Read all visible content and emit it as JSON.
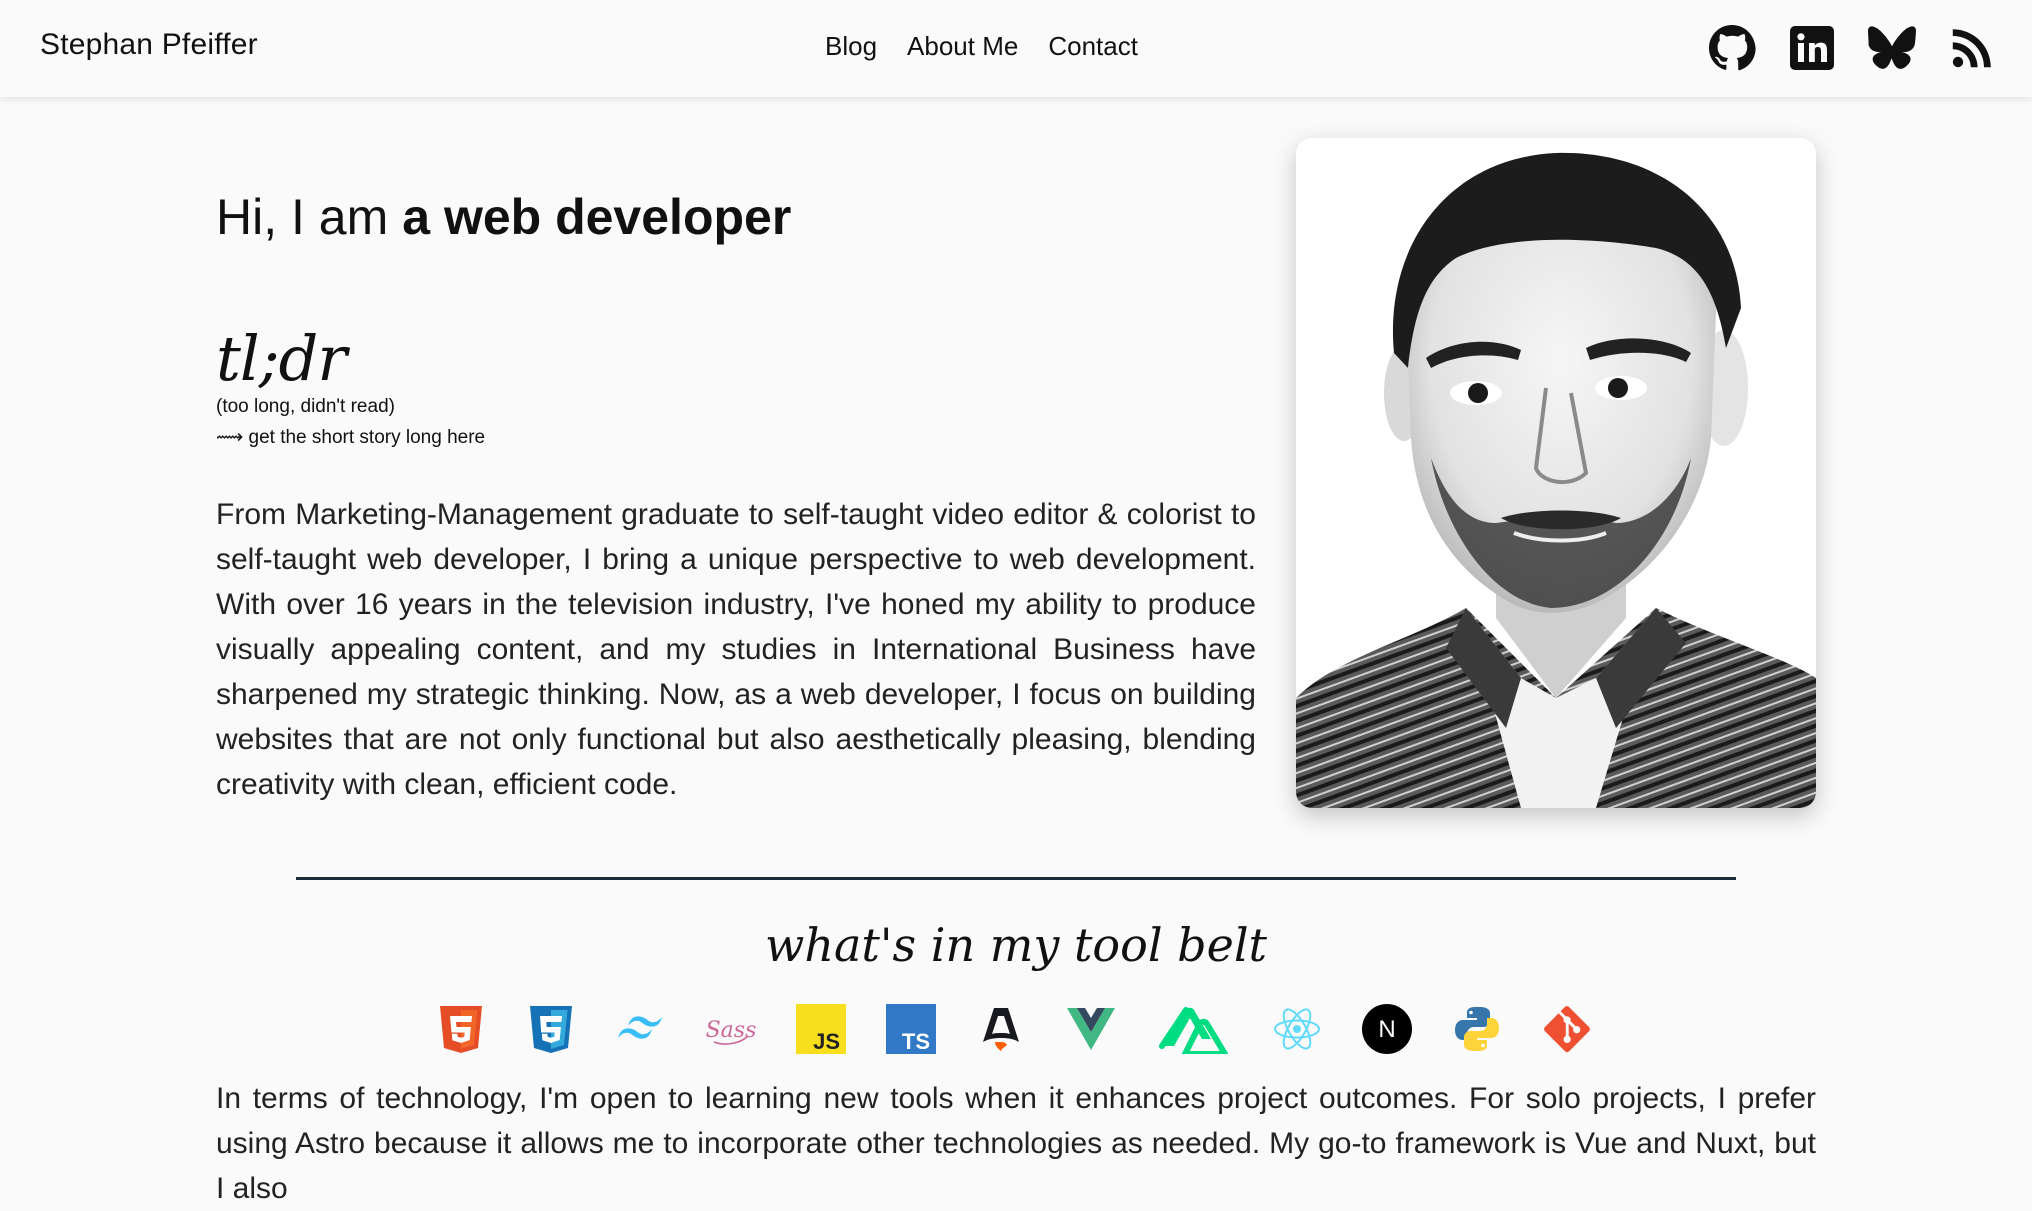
{
  "header": {
    "brand": "Stephan Pfeiffer",
    "nav": [
      "Blog",
      "About Me",
      "Contact"
    ],
    "socials": [
      "github-icon",
      "linkedin-icon",
      "bluesky-icon",
      "rss-icon"
    ]
  },
  "hero": {
    "greeting": "Hi, I am",
    "role": "a web developer"
  },
  "tldr": {
    "heading": "tl;dr",
    "subtitle": "(too long, didn't read)",
    "link": "⟿ get the short story long here"
  },
  "intro": "From Marketing-Management graduate to self-taught video editor & colorist to self-taught web developer, I bring a unique perspective to web development. With over 16 years in the television industry, I've honed my ability to produce visually appealing content, and my studies in International Business have sharpened my strategic thinking. Now, as a web developer, I focus on building websites that are not only functional but also aesthetically pleasing, blending creativity with clean, efficient code.",
  "toolbelt": {
    "heading": "what's in my tool belt",
    "icons": [
      "html5-icon",
      "css3-icon",
      "tailwind-icon",
      "sass-icon",
      "javascript-icon",
      "typescript-icon",
      "astro-icon",
      "vue-icon",
      "nuxt-icon",
      "react-icon",
      "nextjs-icon",
      "python-icon",
      "git-icon"
    ],
    "tool_labels": {
      "sass": "Sass",
      "javascript": "JS",
      "typescript": "TS",
      "nextjs": "N"
    }
  },
  "tech_text": "In terms of technology, I'm open to learning new tools when it enhances project outcomes. For solo projects, I prefer using Astro because it allows me to incorporate other technologies as needed. My go-to framework is Vue and Nuxt, but I also",
  "colors": {
    "html5": "#e44d26",
    "css3": "#1572b6",
    "tailwind": "#38bdf8",
    "sass": "#cd6799",
    "javascript": "#f7df1e",
    "typescript": "#3178c6",
    "vue": "#41b883",
    "nuxt": "#00dc82",
    "react": "#61dafb",
    "git": "#f05032",
    "divider": "#1e2d3d"
  }
}
